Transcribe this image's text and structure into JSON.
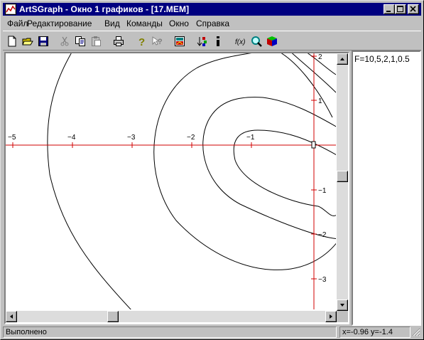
{
  "window": {
    "title": "ArtSGraph - Окно 1 графиков - [17.MEM]"
  },
  "menu": {
    "items": [
      "Файл",
      "Редактирование",
      "Вид",
      "Команды",
      "Окно",
      "Справка"
    ]
  },
  "toolbar": {
    "buttons": [
      "new-file",
      "open-folder",
      "save",
      "cut",
      "copy",
      "paste",
      "print",
      "help",
      "context-help",
      "image",
      "sort",
      "info",
      "function",
      "zoom",
      "cube"
    ]
  },
  "graph": {
    "x_ticks": [
      "−5",
      "−4",
      "−3",
      "−2",
      "−1"
    ],
    "y_ticks": [
      "2",
      "1",
      "−1",
      "−2",
      "−3"
    ],
    "axis_color": "#d00000",
    "curve_color": "#000000",
    "levels": [
      10,
      5,
      2,
      1,
      0.5
    ]
  },
  "legend": {
    "text": "F=10,5,2,1,0.5"
  },
  "status": {
    "message": "Выполнено",
    "coords": "x=-0.96 y=-1.4"
  }
}
